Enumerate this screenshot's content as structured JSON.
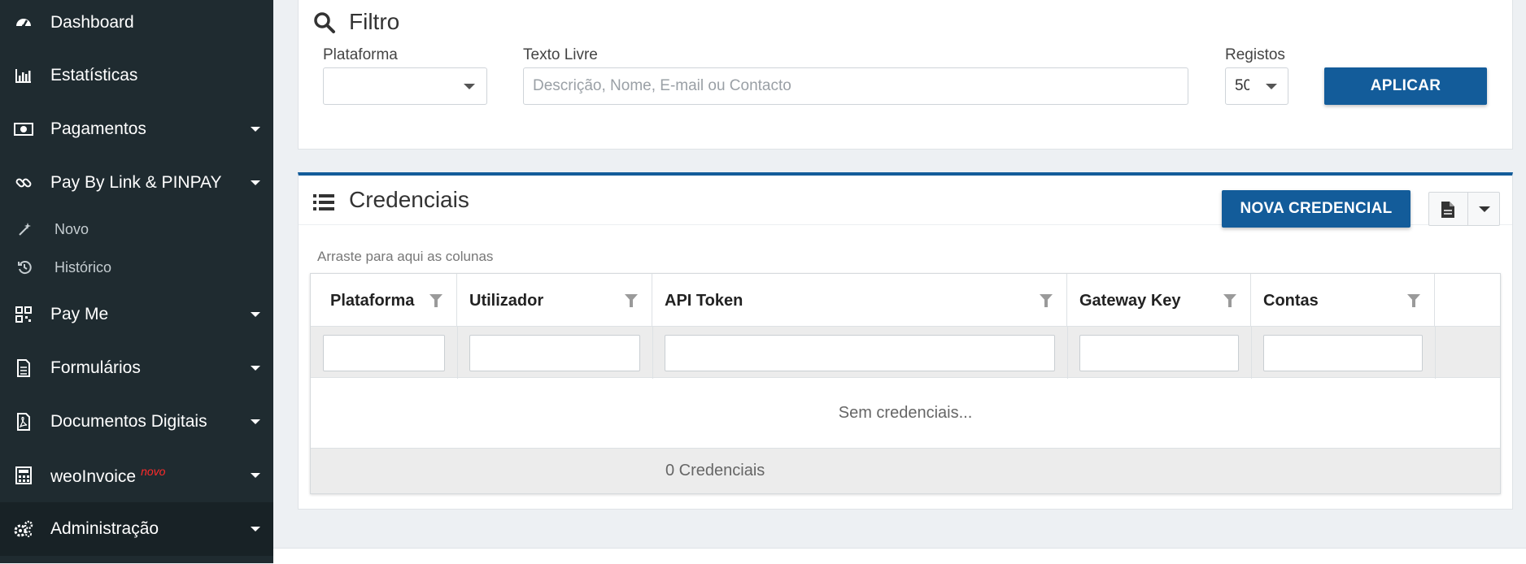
{
  "sidebar": {
    "items": [
      {
        "label": "Dashboard",
        "icon": "dashboard-icon"
      },
      {
        "label": "Estatísticas",
        "icon": "bar-chart-icon"
      },
      {
        "label": "Pagamentos",
        "icon": "money-icon"
      },
      {
        "label": "Pay By Link & PINPAY",
        "icon": "link-icon"
      },
      {
        "label": "Novo",
        "icon": "magic-wand-icon"
      },
      {
        "label": "Histórico",
        "icon": "history-icon"
      },
      {
        "label": "Pay Me",
        "icon": "qrcode-icon"
      },
      {
        "label": "Formulários",
        "icon": "form-icon"
      },
      {
        "label": "Documentos Digitais",
        "icon": "pdf-icon"
      },
      {
        "label": "weoInvoice",
        "icon": "calculator-icon",
        "badge": "novo"
      },
      {
        "label": "Administração",
        "icon": "cogs-icon"
      }
    ]
  },
  "filter": {
    "title": "Filtro",
    "plataforma_label": "Plataforma",
    "plataforma_value": "",
    "texto_label": "Texto Livre",
    "texto_placeholder": "Descrição, Nome, E-mail ou Contacto",
    "registos_label": "Registos",
    "registos_value": "50",
    "apply_label": "APLICAR"
  },
  "credentials": {
    "title": "Credenciais",
    "new_label": "NOVA CREDENCIAL",
    "group_hint": "Arraste para aqui as colunas",
    "columns": [
      "Plataforma",
      "Utilizador",
      "API Token",
      "Gateway Key",
      "Contas"
    ],
    "empty_text": "Sem credenciais...",
    "footer_count": "0 Credenciais"
  },
  "colors": {
    "sidebar_bg": "#1f2b30",
    "accent": "#135c9a",
    "badge": "#ff2a2a"
  }
}
